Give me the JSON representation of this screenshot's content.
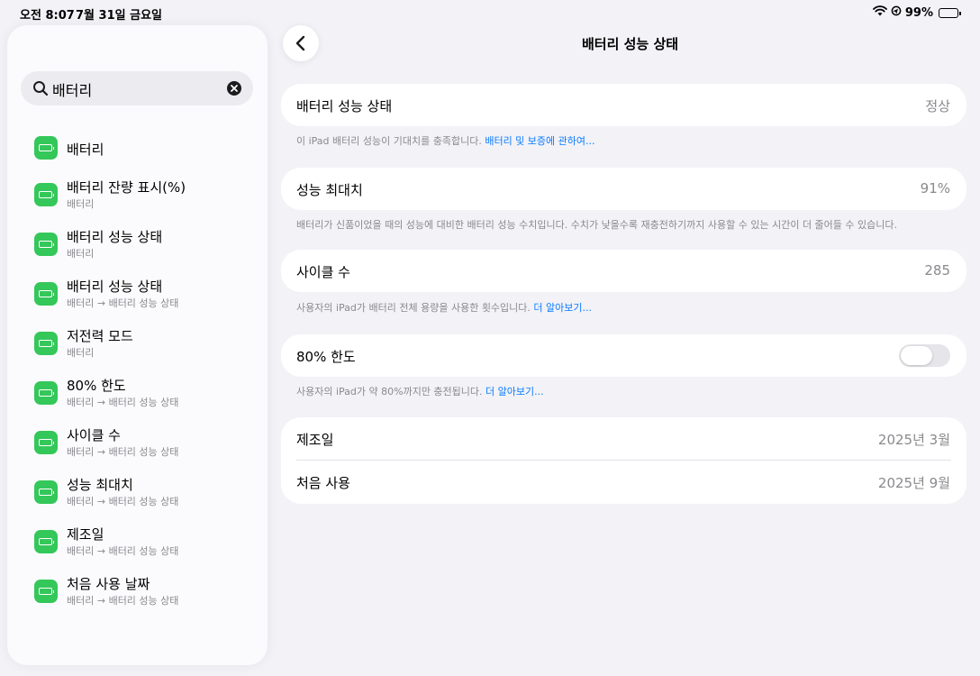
{
  "status_bar": {
    "time": "오전 8:07",
    "date": "7월 31일 금요일",
    "battery_percent": "99%",
    "icons": [
      "wifi-icon",
      "location-icon",
      "battery-icon"
    ]
  },
  "sidebar": {
    "search": {
      "value": "배터리",
      "icon": "search-icon",
      "clear_icon": "clear-icon"
    },
    "results": [
      {
        "title": "배터리",
        "subtitle": ""
      },
      {
        "title": "배터리 잔량 표시(%)",
        "subtitle": "배터리"
      },
      {
        "title": "배터리 성능 상태",
        "subtitle": "배터리"
      },
      {
        "title": "배터리 성능 상태",
        "subtitle": "배터리 → 배터리 성능 상태"
      },
      {
        "title": "저전력 모드",
        "subtitle": "배터리"
      },
      {
        "title": "80% 한도",
        "subtitle": "배터리 → 배터리 성능 상태"
      },
      {
        "title": "사이클 수",
        "subtitle": "배터리 → 배터리 성능 상태"
      },
      {
        "title": "성능 최대치",
        "subtitle": "배터리 → 배터리 성능 상태"
      },
      {
        "title": "제조일",
        "subtitle": "배터리 → 배터리 성능 상태"
      },
      {
        "title": "처음 사용 날짜",
        "subtitle": "배터리 → 배터리 성능 상태"
      }
    ],
    "result_icon": "battery-app-icon",
    "accent_color": "#34c759"
  },
  "main": {
    "title": "배터리 성능 상태",
    "back_icon": "chevron-left-icon",
    "health": {
      "label": "배터리 성능 상태",
      "value": "정상",
      "caption": "이 iPad 배터리 성능이 기대치를 충족합니다.",
      "link": "배터리 및 보증에 관하여..."
    },
    "max_capacity": {
      "label": "성능 최대치",
      "value": "91%",
      "caption": "배터리가 신품이었을 때의 성능에 대비한 배터리 성능 수치입니다. 수치가 낮을수록 재충전하기까지 사용할 수 있는 시간이 더 줄어들 수 있습니다."
    },
    "cycle_count": {
      "label": "사이클 수",
      "value": "285",
      "caption": "사용자의 iPad가 배터리 전체 용량을 사용한 횟수입니다.",
      "link": "더 알아보기..."
    },
    "limit_80": {
      "label": "80% 한도",
      "toggle_on": false,
      "caption": "사용자의 iPad가 약 80%까지만 충전됩니다.",
      "link": "더 알아보기..."
    },
    "dates": {
      "manufacture_label": "제조일",
      "manufacture_value": "2025년 3월",
      "first_use_label": "처음 사용",
      "first_use_value": "2025년 9월"
    },
    "link_color": "#0a7bff"
  }
}
